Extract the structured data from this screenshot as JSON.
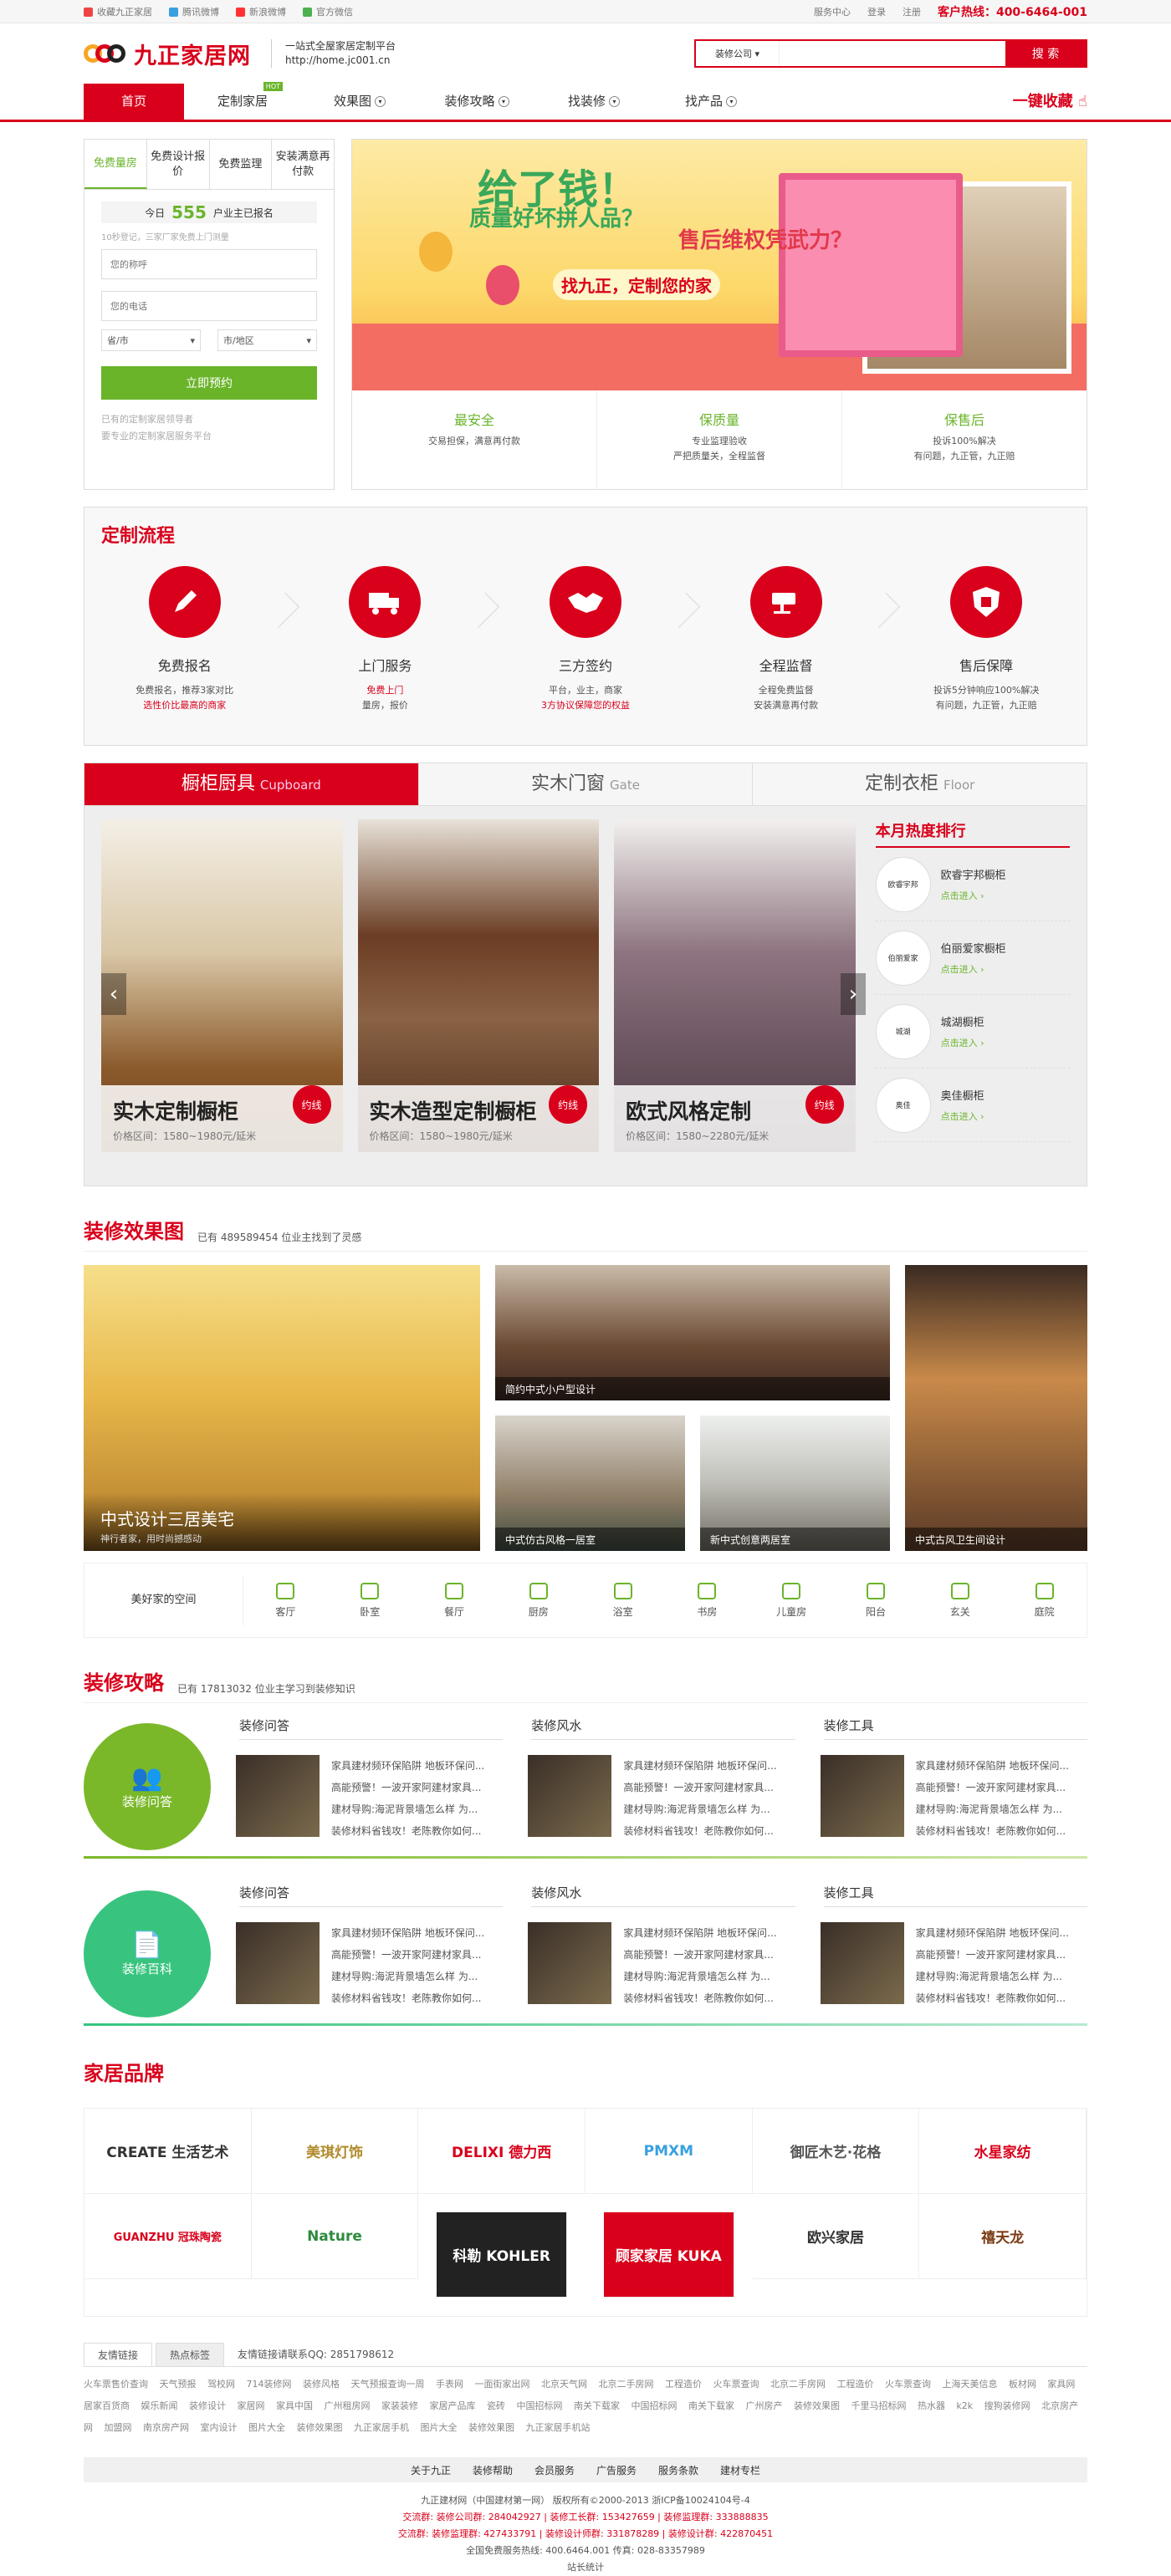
{
  "topbar": {
    "left": [
      "收藏九正家居",
      "腾讯微博",
      "新浪微博",
      "官方微信"
    ],
    "right": [
      "服务中心",
      "登录",
      "注册"
    ],
    "hotline": "客户热线：400-6464-001"
  },
  "header": {
    "logo": "九正家居网",
    "slogan1": "一站式全屋家居定制平台",
    "slogan2": "http://home.jc001.cn",
    "search_select": "装修公司",
    "search_placeholder": "",
    "search_button": "搜 索"
  },
  "nav": {
    "items": [
      "首页",
      "定制家居",
      "效果图",
      "装修攻略",
      "找装修",
      "找产品"
    ],
    "hot_badge": "HOT",
    "collect": "一键收藏"
  },
  "booking": {
    "tabs": [
      "免费量房",
      "免费设计报价",
      "免费监理",
      "安装满意再付款"
    ],
    "today_pre": "今日",
    "today_count": "555",
    "today_post": "户业主已报名",
    "note": "10秒登记，三家厂家免费上门测量",
    "name_ph": "您的称呼",
    "phone_ph": "您的电话",
    "sel1": "省/市",
    "sel2": "市/地区",
    "button": "立即预约",
    "foot1": "已有的定制家居领导者",
    "foot2": "要专业的定制家居服务平台"
  },
  "banner": {
    "t1": "给了钱！",
    "t2": "质量好坏拼人品？",
    "t3": "售后维权凭武力？",
    "t4": "找九正，定制您的家",
    "features": [
      {
        "title": "最安全",
        "desc": "交易担保，满意再付款"
      },
      {
        "title": "保质量",
        "desc": "专业监理验收\n严把质量关，全程监督"
      },
      {
        "title": "保售后",
        "desc": "投诉100%解决\n有问题，九正管，九正赔"
      }
    ]
  },
  "process": {
    "title": "定制流程",
    "steps": [
      {
        "name": "免费报名",
        "l1": "免费报名，推荐3家对比",
        "l2": "选性价比最高的商家"
      },
      {
        "name": "上门服务",
        "l1": "免费上门",
        "l2": "量房，报价"
      },
      {
        "name": "三方签约",
        "l1": "平台，业主，商家",
        "l2": "3方协议保障您的权益"
      },
      {
        "name": "全程监督",
        "l1": "全程免费监督",
        "l2": "安装满意再付款"
      },
      {
        "name": "售后保障",
        "l1": "投诉5分钟响应100%解决",
        "l2": "有问题，九正管，九正赔"
      }
    ]
  },
  "ktabs": [
    {
      "t": "橱柜厨具",
      "s": "Cupboard"
    },
    {
      "t": "实木门窗",
      "s": "Gate"
    },
    {
      "t": "定制衣柜",
      "s": "Floor"
    }
  ],
  "kitchen": [
    {
      "name": "实木定制橱柜",
      "price": "价格区间：1580~1980元/延米",
      "btn": "约线"
    },
    {
      "name": "实木造型定制橱柜",
      "price": "价格区间：1580~1980元/延米",
      "btn": "约线"
    },
    {
      "name": "欧式风格定制",
      "price": "价格区间：1580~2280元/延米",
      "btn": "约线"
    }
  ],
  "rank": {
    "title": "本月热度排行",
    "items": [
      {
        "logo": "欧睿宇邦",
        "name": "欧睿宇邦橱柜",
        "link": "点击进入 ›"
      },
      {
        "logo": "伯丽爱家",
        "name": "伯丽爱家橱柜",
        "link": "点击进入 ›"
      },
      {
        "logo": "城湖",
        "name": "城湖橱柜",
        "link": "点击进入 ›"
      },
      {
        "logo": "奥佳",
        "name": "奥佳橱柜",
        "link": "点击进入 ›"
      }
    ]
  },
  "gallery": {
    "title": "装修效果图",
    "count": "已有 489589454 位业主找到了灵感",
    "big": "中式设计三居美宅",
    "big_sub": "神行者家，用时尚撼感动",
    "items": [
      "简约中式小户型设计",
      "中式仿古风格一居室",
      "新中式创意两居室",
      "中式古风卫生间设计"
    ],
    "rooms_label": "美好家的空间",
    "rooms": [
      "客厅",
      "卧室",
      "餐厅",
      "厨房",
      "浴室",
      "书房",
      "儿童房",
      "阳台",
      "玄关",
      "庭院"
    ]
  },
  "strategy": {
    "title": "装修攻略",
    "count": "已有 17813032 位业主学习到装修知识",
    "rows": [
      {
        "circle": "装修问答",
        "cols": [
          "装修问答",
          "装修风水",
          "装修工具"
        ]
      },
      {
        "circle": "装修百科",
        "cols": [
          "装修问答",
          "装修风水",
          "装修工具"
        ]
      }
    ],
    "lines": [
      "家具建材频环保陷阱 地板环保问...",
      "高能预警！一波开家阿建材家具...",
      "建材导购:海泥背景墙怎么样 为...",
      "装修材料省钱攻！老陈教你如何..."
    ]
  },
  "brands": {
    "title": "家居品牌",
    "items": [
      "CREATE 生活艺术",
      "美琪灯饰",
      "DELIXI 德力西",
      "PMXM",
      "御匠木艺·花格",
      "水星家纺",
      "GUANZHU 冠珠陶瓷",
      "Nature",
      "科勒 KOHLER",
      "顾家家居 KUKA",
      "欧兴家居",
      "禧天龙"
    ]
  },
  "links": {
    "tabs": [
      "友情链接",
      "热点标签"
    ],
    "apply": "友情链接请联系QQ: 2851798612",
    "text": "火车票售价查询 天气预报 驾校网 714装修网 装修风格 天气预报查询一周 手表网 一面街家出网 北京天气网 北京二手房网 工程造价 火车票查询 北京二手房网 工程造价 火车票查询 上海天美信息 板材网 家具网 居家百货商 娱乐新闻 装修设计 家居网 家具中国 广州租房网 家装装修 家居产品库 瓷砖 中国招标网 南关下载家 中国招标网 南关下载家 广州房产 装修效果图 千里马招标网 热水器 k2k 搜狗装修网 北京房产网 加盟网 南京房产网 室内设计 图片大全 装修效果图 九正家居手机 图片大全 装修效果图 九正家居手机站"
  },
  "footer": {
    "nav": [
      "关于九正",
      "装修帮助",
      "会员服务",
      "广告服务",
      "服务条款",
      "建材专栏"
    ],
    "copy1": "九正建材网（中国建材第一网） 版权所有©2000-2013  浙ICP备10024104号-4",
    "copy2": "交流群: 装修公司群: 284042927 | 装修工长群: 153427659 | 装修监理群: 333888835",
    "copy3": "交流群: 装修监理群: 427433791 | 装修设计师群: 331878289 | 装修设计群: 422870451",
    "copy4": "全国免费服务热线: 400.6464.001  传真: 028-83357989",
    "copy5": "站长统计"
  }
}
